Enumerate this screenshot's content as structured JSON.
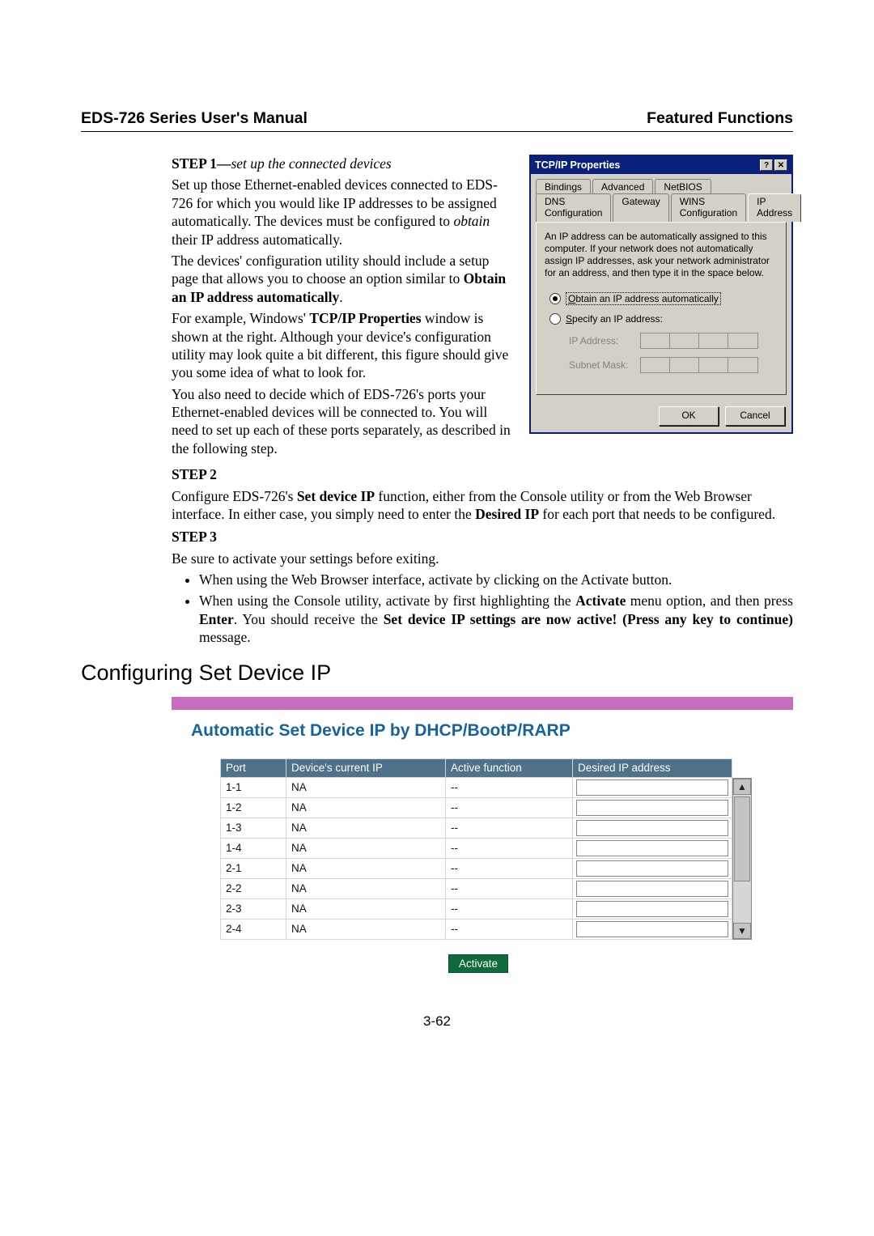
{
  "header": {
    "left": "EDS-726 Series User's Manual",
    "right": "Featured Functions"
  },
  "pageNumber": "3-62",
  "step1": {
    "label": "STEP 1—",
    "em": "set up the connected devices",
    "p1": "Set up those Ethernet-enabled devices connected to EDS-726 for which you would like IP addresses to be assigned automatically. The devices must be configured to ",
    "p1b": "obtain",
    "p1c": " their IP address automatically.",
    "p2a": "The devices' configuration utility should include a setup page that allows you to choose an option similar to ",
    "p2b": "Obtain an IP address automatically",
    "p2c": ".",
    "p3a": "For example, Windows' ",
    "p3b": "TCP/IP Properties",
    "p3c": " window is shown at the right. Although your device's configuration utility may look quite a bit different, this figure should give you some idea of what to look for.",
    "p4": "You also need to decide which of EDS-726's ports your Ethernet-enabled devices will be connected to. You will need to set up each of these ports separately, as described in the following step."
  },
  "step2": {
    "label": "STEP 2",
    "p_a": "Configure EDS-726's ",
    "p_b": "Set device IP",
    "p_c": " function, either from the Console utility or from the Web Browser interface. In either case, you simply need to enter the ",
    "p_d": "Desired IP",
    "p_e": " for each port that needs to be configured."
  },
  "step3": {
    "label": "STEP 3",
    "p": "Be sure to activate your settings before exiting.",
    "li1": "When using the Web Browser interface, activate by clicking on the Activate button.",
    "li2_a": "When using the Console utility, activate by first highlighting the ",
    "li2_b": "Activate",
    "li2_c": " menu option, and then press ",
    "li2_d": "Enter",
    "li2_e": ". You should receive the ",
    "li2_f": "Set device IP settings are now active! (Press any key to continue)",
    "li2_g": " message."
  },
  "sectionTitle": "Configuring Set Device IP",
  "softwarePanel": {
    "title": "Automatic Set Device IP by DHCP/BootP/RARP",
    "headers": [
      "Port",
      "Device's current IP",
      "Active function",
      "Desired IP address"
    ],
    "rows": [
      {
        "port": "1-1",
        "ip": "NA",
        "fn": "--"
      },
      {
        "port": "1-2",
        "ip": "NA",
        "fn": "--"
      },
      {
        "port": "1-3",
        "ip": "NA",
        "fn": "--"
      },
      {
        "port": "1-4",
        "ip": "NA",
        "fn": "--"
      },
      {
        "port": "2-1",
        "ip": "NA",
        "fn": "--"
      },
      {
        "port": "2-2",
        "ip": "NA",
        "fn": "--"
      },
      {
        "port": "2-3",
        "ip": "NA",
        "fn": "--"
      },
      {
        "port": "2-4",
        "ip": "NA",
        "fn": "--"
      }
    ],
    "activate": "Activate"
  },
  "dialog": {
    "title": "TCP/IP Properties",
    "tabs_row1": [
      "Bindings",
      "Advanced",
      "NetBIOS"
    ],
    "tabs_row2": [
      "DNS Configuration",
      "Gateway",
      "WINS Configuration",
      "IP Address"
    ],
    "note": "An IP address can be automatically assigned to this computer. If your network does not automatically assign IP addresses, ask your network administrator for an address, and then type it in the space below.",
    "optObtain": "Obtain an IP address automatically",
    "optSpecify": "Specify an IP address:",
    "lblIP": "IP Address:",
    "lblMask": "Subnet Mask:",
    "ok": "OK",
    "cancel": "Cancel",
    "help": "?",
    "close": "✕"
  }
}
